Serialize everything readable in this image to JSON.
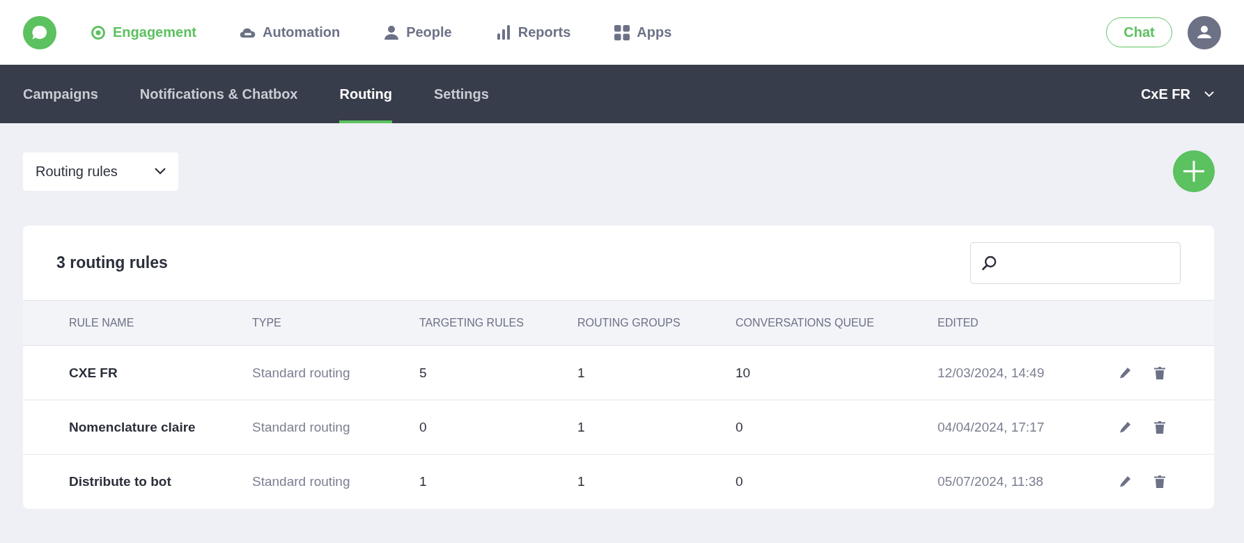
{
  "top_nav": {
    "items": [
      {
        "label": "Engagement",
        "selected": true
      },
      {
        "label": "Automation",
        "selected": false
      },
      {
        "label": "People",
        "selected": false
      },
      {
        "label": "Reports",
        "selected": false
      },
      {
        "label": "Apps",
        "selected": false
      }
    ],
    "chat_button": "Chat"
  },
  "sub_nav": {
    "tabs": [
      {
        "label": "Campaigns",
        "selected": false
      },
      {
        "label": "Notifications & Chatbox",
        "selected": false
      },
      {
        "label": "Routing",
        "selected": true
      },
      {
        "label": "Settings",
        "selected": false
      }
    ],
    "workspace": "CxE FR"
  },
  "view_select": "Routing rules",
  "table": {
    "title": "3 routing rules",
    "columns": [
      "RULE NAME",
      "TYPE",
      "TARGETING RULES",
      "ROUTING GROUPS",
      "CONVERSATIONS QUEUE",
      "EDITED"
    ],
    "rows": [
      {
        "name": "CXE FR",
        "type": "Standard routing",
        "targeting_rules": "5",
        "routing_groups": "1",
        "queue": "10",
        "edited": "12/03/2024, 14:49"
      },
      {
        "name": "Nomenclature claire",
        "type": "Standard routing",
        "targeting_rules": "0",
        "routing_groups": "1",
        "queue": "0",
        "edited": "04/04/2024, 17:17"
      },
      {
        "name": "Distribute to bot",
        "type": "Standard routing",
        "targeting_rules": "1",
        "routing_groups": "1",
        "queue": "0",
        "edited": "05/07/2024, 11:38"
      }
    ]
  }
}
